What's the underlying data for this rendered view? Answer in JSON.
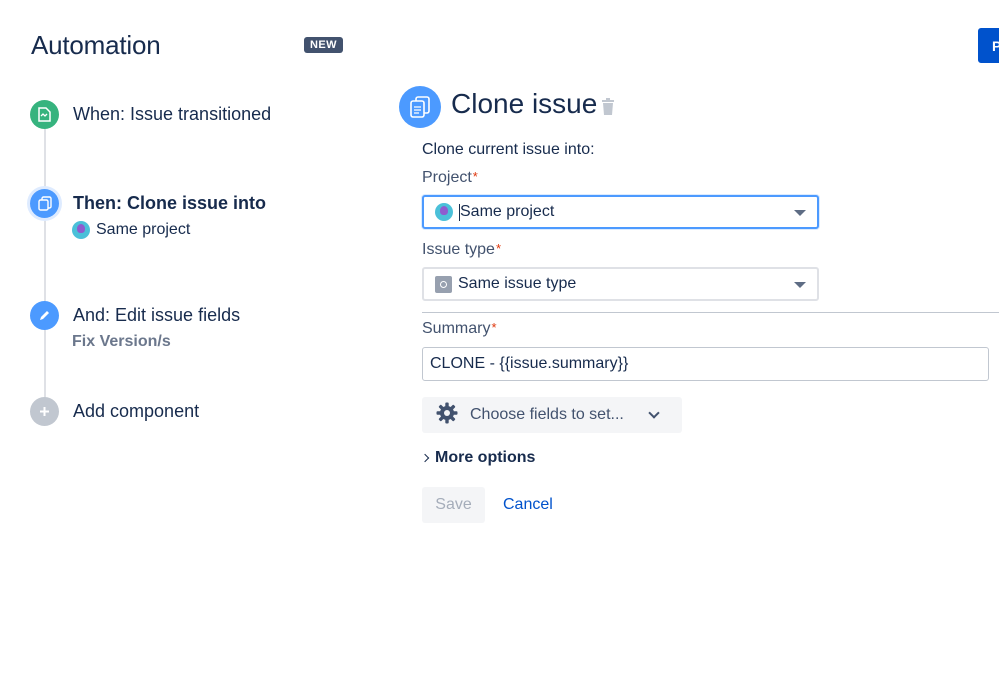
{
  "header": {
    "title": "Automation",
    "badge": "NEW",
    "top_right_button": "P"
  },
  "rule_steps": [
    {
      "label": "When: Issue transitioned",
      "icon": "trigger-icon",
      "color": "#36b37e"
    },
    {
      "label": "Then: Clone issue into",
      "sub": "Same project",
      "icon": "clone-icon",
      "color": "#4c9aff"
    },
    {
      "label": "And: Edit issue fields",
      "sub": "Fix Version/s",
      "icon": "pencil-icon",
      "color": "#4c9aff"
    },
    {
      "label": "Add component",
      "icon": "plus-icon",
      "color": "#c1c7d0"
    }
  ],
  "panel": {
    "title": "Clone issue",
    "intro": "Clone current issue into:",
    "project_label": "Project",
    "project_value": "Same project",
    "issue_type_label": "Issue type",
    "issue_type_value": "Same issue type",
    "summary_label": "Summary",
    "summary_value": "CLONE - {{issue.summary}}",
    "required_marker": "*",
    "fields_button": "Choose fields to set...",
    "more_options": "More options",
    "save": "Save",
    "cancel": "Cancel"
  },
  "colors": {
    "primary": "#0052cc",
    "text": "#172b4d",
    "required": "#de350b",
    "focus": "#4c9aff"
  }
}
